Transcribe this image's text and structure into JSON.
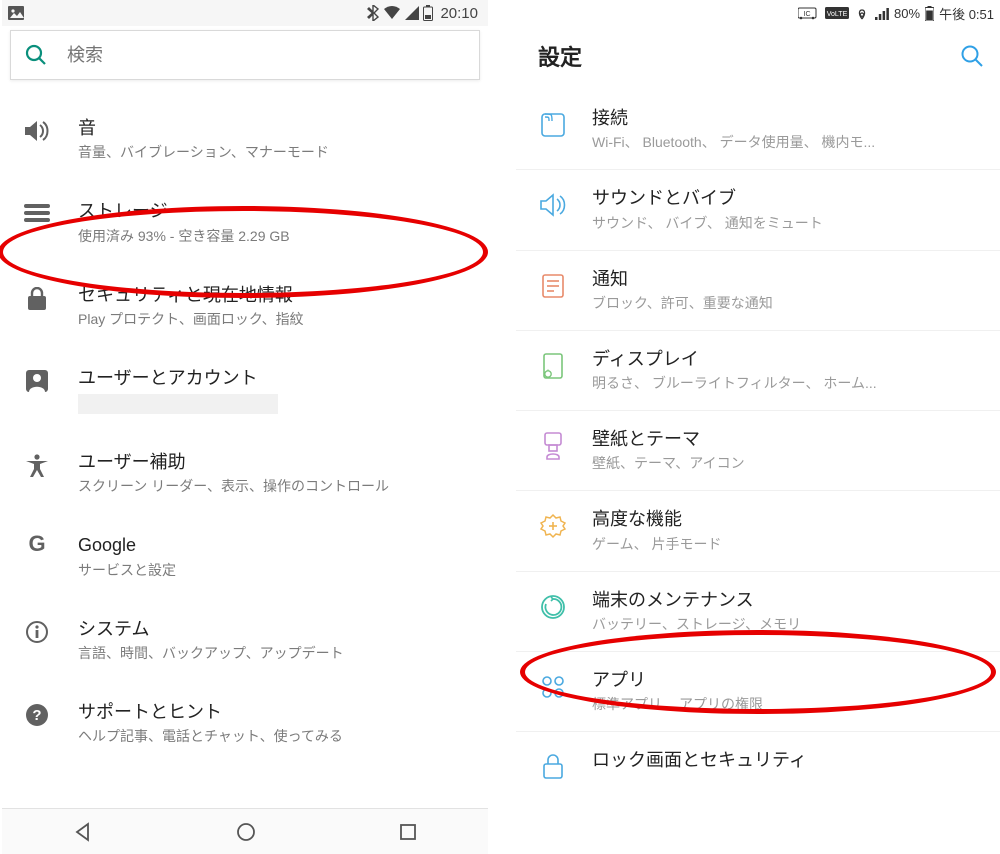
{
  "left": {
    "statusbar": {
      "time": "20:10"
    },
    "search": {
      "placeholder": "検索"
    },
    "items": [
      {
        "title": "音",
        "sub": "音量、バイブレーション、マナーモード"
      },
      {
        "title": "ストレージ",
        "sub": "使用済み 93% - 空き容量 2.29 GB"
      },
      {
        "title": "セキュリティと現在地情報",
        "sub": "Play プロテクト、画面ロック、指紋"
      },
      {
        "title": "ユーザーとアカウント",
        "sub": ""
      },
      {
        "title": "ユーザー補助",
        "sub": "スクリーン リーダー、表示、操作のコントロール"
      },
      {
        "title": "Google",
        "sub": "サービスと設定"
      },
      {
        "title": "システム",
        "sub": "言語、時間、バックアップ、アップデート"
      },
      {
        "title": "サポートとヒント",
        "sub": "ヘルプ記事、電話とチャット、使ってみる"
      }
    ]
  },
  "right": {
    "statusbar": {
      "battery": "80%",
      "time": "午後 0:51"
    },
    "header": {
      "title": "設定"
    },
    "items": [
      {
        "title": "接続",
        "sub": "Wi-Fi、 Bluetooth、 データ使用量、 機内モ..."
      },
      {
        "title": "サウンドとバイブ",
        "sub": "サウンド、 バイブ、 通知をミュート"
      },
      {
        "title": "通知",
        "sub": "ブロック、許可、重要な通知"
      },
      {
        "title": "ディスプレイ",
        "sub": "明るさ、 ブルーライトフィルター、 ホーム..."
      },
      {
        "title": "壁紙とテーマ",
        "sub": "壁紙、テーマ、アイコン"
      },
      {
        "title": "高度な機能",
        "sub": "ゲーム、 片手モード"
      },
      {
        "title": "端末のメンテナンス",
        "sub": "バッテリー、ストレージ、メモリ"
      },
      {
        "title": "アプリ",
        "sub": "標準アプリ、 アプリの権限"
      },
      {
        "title": "ロック画面とセキュリティ",
        "sub": ""
      }
    ]
  }
}
